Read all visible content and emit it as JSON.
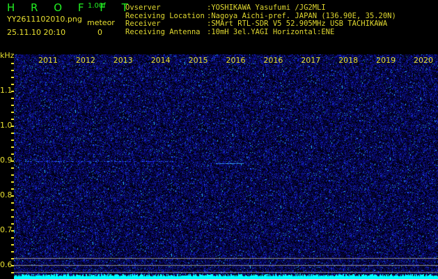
{
  "header": {
    "app_title": "H R O F F T",
    "version": "1.00f",
    "filename": "YY2611102010.png",
    "datetime": "25.11.10 20:10",
    "meteor_label": "meteor",
    "meteor_count": "0"
  },
  "info": [
    {
      "label": "Ovserver",
      "value": ":YOSHIKAWA Yasufumi /JG2MLI"
    },
    {
      "label": "Receiving Location",
      "value": ":Nagoya Aichi-pref. JAPAN (136.90E, 35.20N)"
    },
    {
      "label": "Receiver",
      "value": ":SMArt RTL-SDR V5 52.905MHz USB TACHIKAWA"
    },
    {
      "label": "Receiving Antenna",
      "value": ":10mH 3el.YAGI Horizontal:ENE"
    }
  ],
  "axis": {
    "unit": "kHz",
    "freq_labels": [
      "1.1",
      "1.0",
      "0.9",
      "0.8",
      "0.7",
      "0.6"
    ],
    "time_labels": [
      "2011",
      "2012",
      "2013",
      "2014",
      "2015",
      "2016",
      "2016",
      "2017",
      "2018",
      "2019",
      "2020"
    ]
  },
  "colors": {
    "noise": "#1a1acc",
    "bright": "#33ddff",
    "text": "#e8e030",
    "title": "#22ee22",
    "baseline": "#00ffff"
  }
}
